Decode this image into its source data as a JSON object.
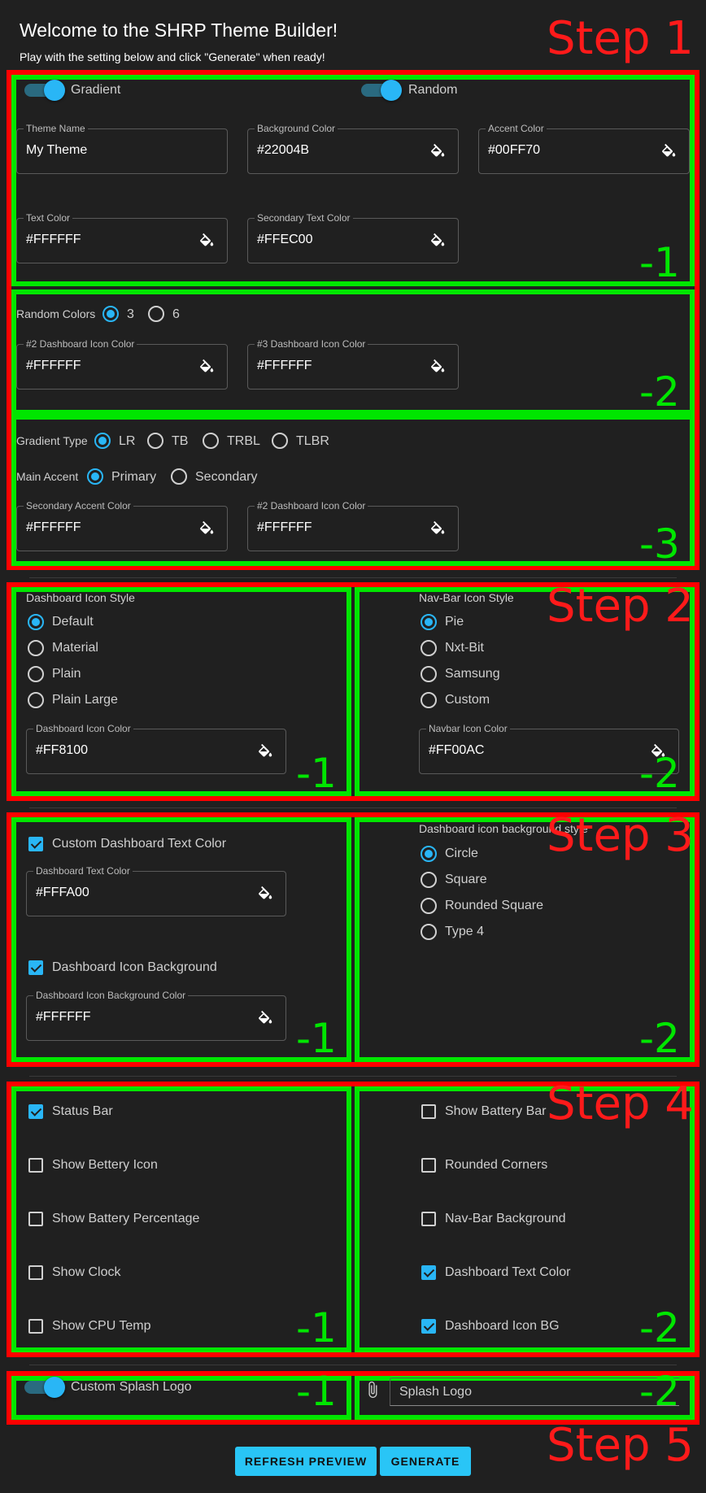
{
  "header": {
    "title": "Welcome to the SHRP Theme Builder!",
    "subtitle": "Play with the setting below and click \"Generate\" when ready!"
  },
  "annotations": {
    "step1": "Step 1",
    "step2": "Step 2",
    "step3": "Step 3",
    "step4": "Step 4",
    "step5": "Step 5",
    "sub1": "-1",
    "sub2": "-2",
    "sub3": "-3"
  },
  "colors": {
    "accent": "#29b6f6",
    "annotation_red": "#ff0000",
    "annotation_green": "#00e600",
    "background": "#202020"
  },
  "step1": {
    "gradient_label": "Gradient",
    "gradient_on": true,
    "random_label": "Random",
    "random_on": true,
    "theme_name": {
      "label": "Theme Name",
      "value": "My Theme"
    },
    "background_color": {
      "label": "Background Color",
      "value": "#22004B"
    },
    "accent_color": {
      "label": "Accent Color",
      "value": "#00FF70"
    },
    "text_color": {
      "label": "Text Color",
      "value": "#FFFFFF"
    },
    "secondary_text_color": {
      "label": "Secondary Text Color",
      "value": "#FFEC00"
    },
    "random_colors": {
      "label": "Random Colors",
      "options": [
        "3",
        "6"
      ],
      "selected": "3"
    },
    "dash2_color": {
      "label": "#2 Dashboard Icon Color",
      "value": "#FFFFFF"
    },
    "dash3_color": {
      "label": "#3 Dashboard Icon Color",
      "value": "#FFFFFF"
    },
    "gradient_type": {
      "label": "Gradient Type",
      "options": [
        "LR",
        "TB",
        "TRBL",
        "TLBR"
      ],
      "selected": "LR"
    },
    "main_accent": {
      "label": "Main Accent",
      "options": [
        "Primary",
        "Secondary"
      ],
      "selected": "Primary"
    },
    "secondary_accent_color": {
      "label": "Secondary Accent Color",
      "value": "#FFFFFF"
    },
    "dash2_color_b": {
      "label": "#2 Dashboard Icon Color",
      "value": "#FFFFFF"
    }
  },
  "step2": {
    "dashboard_icon_style": {
      "label": "Dashboard Icon Style",
      "options": [
        "Default",
        "Material",
        "Plain",
        "Plain Large"
      ],
      "selected": "Default"
    },
    "dashboard_icon_color": {
      "label": "Dashboard Icon Color",
      "value": "#FF8100"
    },
    "navbar_icon_style": {
      "label": "Nav-Bar Icon Style",
      "options": [
        "Pie",
        "Nxt-Bit",
        "Samsung",
        "Custom"
      ],
      "selected": "Pie"
    },
    "navbar_icon_color": {
      "label": "Navbar Icon Color",
      "value": "#FF00AC"
    }
  },
  "step3": {
    "custom_text_color": {
      "label": "Custom Dashboard Text Color",
      "checked": true
    },
    "dashboard_text_color": {
      "label": "Dashboard Text Color",
      "value": "#FFFA00"
    },
    "icon_background": {
      "label": "Dashboard Icon Background",
      "checked": true
    },
    "icon_background_color": {
      "label": "Dashboard Icon Background Color",
      "value": "#FFFFFF"
    },
    "bg_style": {
      "label": "Dashboard icon background style",
      "options": [
        "Circle",
        "Square",
        "Rounded Square",
        "Type 4"
      ],
      "selected": "Circle"
    }
  },
  "step4": {
    "left": [
      {
        "label": "Status Bar",
        "checked": true
      },
      {
        "label": "Show Bettery Icon",
        "checked": false
      },
      {
        "label": "Show Battery Percentage",
        "checked": false
      },
      {
        "label": "Show Clock",
        "checked": false
      },
      {
        "label": "Show CPU Temp",
        "checked": false
      }
    ],
    "right": [
      {
        "label": "Show Battery Bar",
        "checked": false
      },
      {
        "label": "Rounded Corners",
        "checked": false
      },
      {
        "label": "Nav-Bar Background",
        "checked": false
      },
      {
        "label": "Dashboard Text Color",
        "checked": true
      },
      {
        "label": "Dashboard Icon BG",
        "checked": true
      }
    ]
  },
  "step5": {
    "splash_label": "Custom Splash Logo",
    "splash_on": true,
    "splash_file_placeholder": "Splash Logo"
  },
  "buttons": {
    "refresh": "REFRESH PREVIEW",
    "generate": "GENERATE"
  }
}
